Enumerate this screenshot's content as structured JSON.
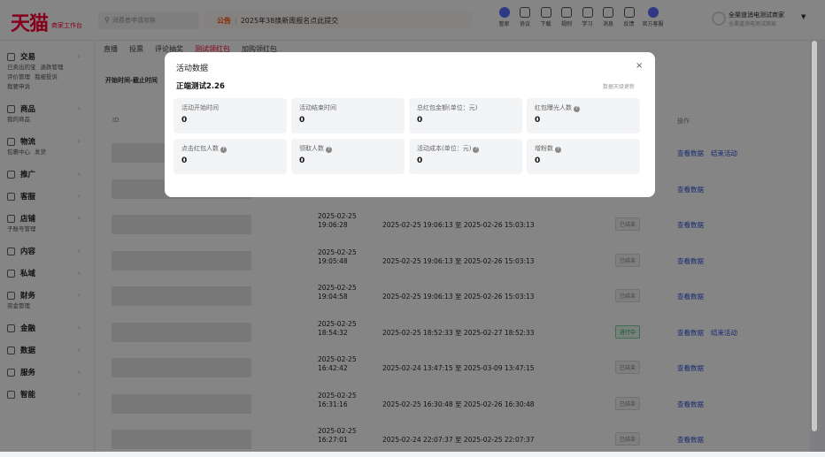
{
  "header": {
    "logo": "天猫",
    "logo_sub": "商家工作台",
    "search_placeholder": "消费者申请攻略",
    "notice_tag": "公告",
    "notice_text": "2025年38焕新周报名点此提交",
    "tools": [
      {
        "label": "管家",
        "icon": "butler-icon"
      },
      {
        "label": "协议",
        "icon": "agreement-icon"
      },
      {
        "label": "下载",
        "icon": "download-icon"
      },
      {
        "label": "规则",
        "icon": "rules-icon"
      },
      {
        "label": "学习",
        "icon": "learn-icon"
      },
      {
        "label": "消息",
        "icon": "message-icon"
      },
      {
        "label": "反馈",
        "icon": "feedback-icon"
      },
      {
        "label": "官方客服",
        "icon": "customer-service-icon"
      }
    ],
    "user_name": "全渠道消电测试商家",
    "user_sub": "全渠道消电测试商家"
  },
  "sidebar": [
    {
      "title": "交易",
      "links": [
        "已卖出的宝",
        "退款管理",
        "评价管理",
        "我被投诉",
        "我要申诉"
      ]
    },
    {
      "title": "商品",
      "links": [
        "我的商品"
      ]
    },
    {
      "title": "物流",
      "links": [
        "包裹中心",
        "发货"
      ]
    },
    {
      "title": "推广",
      "links": []
    },
    {
      "title": "客服",
      "links": []
    },
    {
      "title": "店铺",
      "links": [
        "子账号管理"
      ]
    },
    {
      "title": "内容",
      "links": []
    },
    {
      "title": "私域",
      "links": []
    },
    {
      "title": "财务",
      "links": [
        "资金管理"
      ]
    },
    {
      "title": "金融",
      "links": []
    },
    {
      "title": "数据",
      "links": []
    },
    {
      "title": "服务",
      "links": []
    },
    {
      "title": "智能",
      "links": []
    }
  ],
  "main": {
    "tabs": [
      "直播",
      "投票",
      "评论抽奖",
      "测试领红包",
      "加购领红包"
    ],
    "active_tab": 3,
    "filter_label": "开始时间-截止时间",
    "col_id": "ID",
    "col_ops": "操作",
    "rows": [
      {
        "created": "",
        "range": "",
        "status": "",
        "ops": [
          "查看数据",
          "结束活动"
        ]
      },
      {
        "created": "",
        "range": "",
        "status": "",
        "ops": [
          "查看数据"
        ]
      },
      {
        "created": "2025-02-25 19:06:28",
        "range": "2025-02-25 19:06:13 至 2025-02-26 15:03:13",
        "status": "已结束",
        "ops": [
          "查看数据"
        ]
      },
      {
        "created": "2025-02-25 19:05:48",
        "range": "2025-02-25 19:06:13 至 2025-02-26 15:03:13",
        "status": "已结束",
        "ops": [
          "查看数据"
        ]
      },
      {
        "created": "2025-02-25 19:04:58",
        "range": "2025-02-25 19:06:13 至 2025-02-26 15:03:13",
        "status": "已结束",
        "ops": [
          "查看数据"
        ]
      },
      {
        "created": "2025-02-25 18:54:32",
        "range": "2025-02-25 18:52:33 至 2025-02-27 18:52:33",
        "status": "进行中",
        "ops": [
          "查看数据",
          "结束活动"
        ]
      },
      {
        "created": "2025-02-25 16:42:42",
        "range": "2025-02-24 13:47:15 至 2025-03-09 13:47:15",
        "status": "已结束",
        "ops": [
          "查看数据"
        ]
      },
      {
        "created": "2025-02-25 16:31:16",
        "range": "2025-02-25 16:30:48 至 2025-02-26 16:30:48",
        "status": "已结束",
        "ops": [
          "查看数据"
        ]
      },
      {
        "created": "2025-02-25 16:27:01",
        "range": "2025-02-24 22:07:37 至 2025-02-25 22:07:37",
        "status": "已结束",
        "ops": [
          "查看数据"
        ]
      }
    ]
  },
  "modal": {
    "title": "活动数据",
    "close": "×",
    "activity_name": "正端测试2.26",
    "note": "数据天级更新",
    "cards": [
      {
        "label": "活动开始时间",
        "value": "0",
        "help": false
      },
      {
        "label": "活动结束时间",
        "value": "0",
        "help": false
      },
      {
        "label": "总红包金额(单位：元)",
        "value": "0",
        "help": false
      },
      {
        "label": "红包曝光人数",
        "value": "0",
        "help": true
      },
      {
        "label": "点击红包人数",
        "value": "0",
        "help": true
      },
      {
        "label": "领取人数",
        "value": "0",
        "help": true
      },
      {
        "label": "活动成本(单位：元)",
        "value": "0",
        "help": true
      },
      {
        "label": "增粉数",
        "value": "0",
        "help": true
      }
    ]
  }
}
